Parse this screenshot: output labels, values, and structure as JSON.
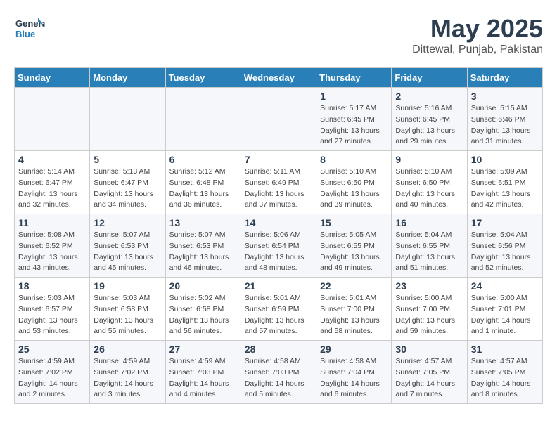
{
  "logo": {
    "line1": "General",
    "line2": "Blue"
  },
  "title": "May 2025",
  "location": "Dittewal, Punjab, Pakistan",
  "days_of_week": [
    "Sunday",
    "Monday",
    "Tuesday",
    "Wednesday",
    "Thursday",
    "Friday",
    "Saturday"
  ],
  "weeks": [
    [
      {
        "num": "",
        "detail": ""
      },
      {
        "num": "",
        "detail": ""
      },
      {
        "num": "",
        "detail": ""
      },
      {
        "num": "",
        "detail": ""
      },
      {
        "num": "1",
        "detail": "Sunrise: 5:17 AM\nSunset: 6:45 PM\nDaylight: 13 hours\nand 27 minutes."
      },
      {
        "num": "2",
        "detail": "Sunrise: 5:16 AM\nSunset: 6:45 PM\nDaylight: 13 hours\nand 29 minutes."
      },
      {
        "num": "3",
        "detail": "Sunrise: 5:15 AM\nSunset: 6:46 PM\nDaylight: 13 hours\nand 31 minutes."
      }
    ],
    [
      {
        "num": "4",
        "detail": "Sunrise: 5:14 AM\nSunset: 6:47 PM\nDaylight: 13 hours\nand 32 minutes."
      },
      {
        "num": "5",
        "detail": "Sunrise: 5:13 AM\nSunset: 6:47 PM\nDaylight: 13 hours\nand 34 minutes."
      },
      {
        "num": "6",
        "detail": "Sunrise: 5:12 AM\nSunset: 6:48 PM\nDaylight: 13 hours\nand 36 minutes."
      },
      {
        "num": "7",
        "detail": "Sunrise: 5:11 AM\nSunset: 6:49 PM\nDaylight: 13 hours\nand 37 minutes."
      },
      {
        "num": "8",
        "detail": "Sunrise: 5:10 AM\nSunset: 6:50 PM\nDaylight: 13 hours\nand 39 minutes."
      },
      {
        "num": "9",
        "detail": "Sunrise: 5:10 AM\nSunset: 6:50 PM\nDaylight: 13 hours\nand 40 minutes."
      },
      {
        "num": "10",
        "detail": "Sunrise: 5:09 AM\nSunset: 6:51 PM\nDaylight: 13 hours\nand 42 minutes."
      }
    ],
    [
      {
        "num": "11",
        "detail": "Sunrise: 5:08 AM\nSunset: 6:52 PM\nDaylight: 13 hours\nand 43 minutes."
      },
      {
        "num": "12",
        "detail": "Sunrise: 5:07 AM\nSunset: 6:53 PM\nDaylight: 13 hours\nand 45 minutes."
      },
      {
        "num": "13",
        "detail": "Sunrise: 5:07 AM\nSunset: 6:53 PM\nDaylight: 13 hours\nand 46 minutes."
      },
      {
        "num": "14",
        "detail": "Sunrise: 5:06 AM\nSunset: 6:54 PM\nDaylight: 13 hours\nand 48 minutes."
      },
      {
        "num": "15",
        "detail": "Sunrise: 5:05 AM\nSunset: 6:55 PM\nDaylight: 13 hours\nand 49 minutes."
      },
      {
        "num": "16",
        "detail": "Sunrise: 5:04 AM\nSunset: 6:55 PM\nDaylight: 13 hours\nand 51 minutes."
      },
      {
        "num": "17",
        "detail": "Sunrise: 5:04 AM\nSunset: 6:56 PM\nDaylight: 13 hours\nand 52 minutes."
      }
    ],
    [
      {
        "num": "18",
        "detail": "Sunrise: 5:03 AM\nSunset: 6:57 PM\nDaylight: 13 hours\nand 53 minutes."
      },
      {
        "num": "19",
        "detail": "Sunrise: 5:03 AM\nSunset: 6:58 PM\nDaylight: 13 hours\nand 55 minutes."
      },
      {
        "num": "20",
        "detail": "Sunrise: 5:02 AM\nSunset: 6:58 PM\nDaylight: 13 hours\nand 56 minutes."
      },
      {
        "num": "21",
        "detail": "Sunrise: 5:01 AM\nSunset: 6:59 PM\nDaylight: 13 hours\nand 57 minutes."
      },
      {
        "num": "22",
        "detail": "Sunrise: 5:01 AM\nSunset: 7:00 PM\nDaylight: 13 hours\nand 58 minutes."
      },
      {
        "num": "23",
        "detail": "Sunrise: 5:00 AM\nSunset: 7:00 PM\nDaylight: 13 hours\nand 59 minutes."
      },
      {
        "num": "24",
        "detail": "Sunrise: 5:00 AM\nSunset: 7:01 PM\nDaylight: 14 hours\nand 1 minute."
      }
    ],
    [
      {
        "num": "25",
        "detail": "Sunrise: 4:59 AM\nSunset: 7:02 PM\nDaylight: 14 hours\nand 2 minutes."
      },
      {
        "num": "26",
        "detail": "Sunrise: 4:59 AM\nSunset: 7:02 PM\nDaylight: 14 hours\nand 3 minutes."
      },
      {
        "num": "27",
        "detail": "Sunrise: 4:59 AM\nSunset: 7:03 PM\nDaylight: 14 hours\nand 4 minutes."
      },
      {
        "num": "28",
        "detail": "Sunrise: 4:58 AM\nSunset: 7:03 PM\nDaylight: 14 hours\nand 5 minutes."
      },
      {
        "num": "29",
        "detail": "Sunrise: 4:58 AM\nSunset: 7:04 PM\nDaylight: 14 hours\nand 6 minutes."
      },
      {
        "num": "30",
        "detail": "Sunrise: 4:57 AM\nSunset: 7:05 PM\nDaylight: 14 hours\nand 7 minutes."
      },
      {
        "num": "31",
        "detail": "Sunrise: 4:57 AM\nSunset: 7:05 PM\nDaylight: 14 hours\nand 8 minutes."
      }
    ]
  ]
}
